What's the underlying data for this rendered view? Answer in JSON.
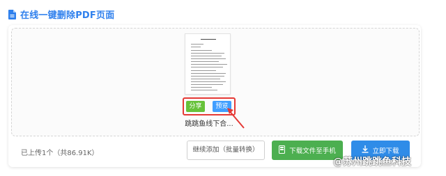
{
  "header": {
    "title": "在线一键删除PDF页面",
    "icon": "document-icon"
  },
  "file": {
    "name": "跳跳鱼线下合...",
    "share_label": "分享",
    "preview_label": "预览"
  },
  "footer": {
    "uploaded_text": "已上传1个（共86.91K）",
    "continue_label": "继续添加（批量转换）",
    "download_phone_label": "下载文件至手机",
    "download_now_label": "立即下载"
  },
  "watermark": {
    "text": "@苏州跳跳鱼科技"
  },
  "colors": {
    "title": "#2f80ed",
    "share": "#67c23a",
    "preview": "#409eff",
    "highlight": "#e53935",
    "download_phone": "#4caf50",
    "download_now": "#2f8ce8"
  }
}
